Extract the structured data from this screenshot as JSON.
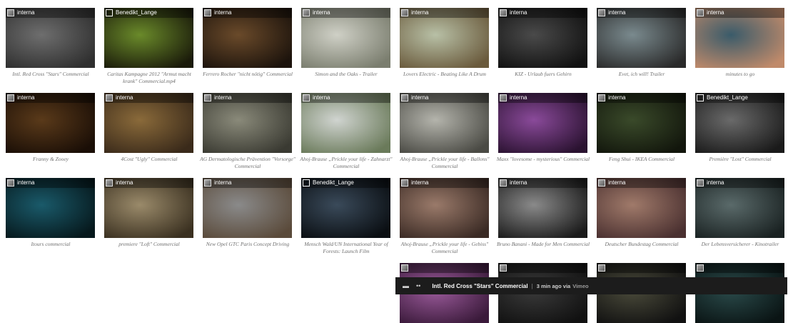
{
  "colors": {
    "player_bg": "#1c1c1c",
    "caption": "#6f6f6f",
    "page_bg": "#ffffff"
  },
  "videos": [
    {
      "author": "interna",
      "title": "Intl. Red Cross \"Stars\" Commercial",
      "thumb": "#6e6e6e,#2f2f2f"
    },
    {
      "author": "Benedikt_Lange",
      "title": "Caritas Kampagne 2012 \"Armut macht krank\" Commercial.mp4",
      "thumb": "#6a8a2a,#1a1a0a"
    },
    {
      "author": "interna",
      "title": "Ferrero Rocher \"nicht nötig\" Commercial",
      "thumb": "#6a4a2a,#1c130c"
    },
    {
      "author": "interna",
      "title": "Simon and the Oaks - Trailer",
      "thumb": "#cfd0c6,#7a7d6e"
    },
    {
      "author": "interna",
      "title": "Lovers Electric - Beating Like A Drum",
      "thumb": "#b8c0a6,#6a5a3c"
    },
    {
      "author": "interna",
      "title": "KIZ - Urlaub fuers Gehirn",
      "thumb": "#4a4a4a,#111111"
    },
    {
      "author": "interna",
      "title": "Evet, ich will! Trailer",
      "thumb": "#7a8a8e,#2a2a2a"
    },
    {
      "author": "interna",
      "title": "minutes to go",
      "thumb": "#3a5b6a,#c08a6a"
    },
    {
      "author": "interna",
      "title": "Franny & Zooey",
      "thumb": "#5a3a1a,#1a0e06"
    },
    {
      "author": "interna",
      "title": "4Cost \"Ugly\" Commercial",
      "thumb": "#8a6a3a,#3a2a1a"
    },
    {
      "author": "interna",
      "title": "AG Dermatologische Prävention \"Vorsorge\" Commercial",
      "thumb": "#8a8a7a,#3a3a32"
    },
    {
      "author": "interna",
      "title": "Ahoj-Brause „Prickle your life - Zahnarzt\" Commercial",
      "thumb": "#d0d4d0,#6a7a5a"
    },
    {
      "author": "interna",
      "title": "Ahoj-Brause „Prickle your life - Ballons\" Commercial",
      "thumb": "#b4b4ac,#4a4a44"
    },
    {
      "author": "interna",
      "title": "Maxx \"lovesome - mysterious\" Commercial",
      "thumb": "#8a4a9a,#2a1230"
    },
    {
      "author": "interna",
      "title": "Feng Shui - IKEA Commercial",
      "thumb": "#3a4a2a,#12160c"
    },
    {
      "author": "Benedikt_Lange",
      "title": "Première \"Lost\" Commercial",
      "thumb": "#6a6a6a,#1a1a1a"
    },
    {
      "author": "interna",
      "title": "Itours commercial",
      "thumb": "#1a5a6a,#06181c"
    },
    {
      "author": "interna",
      "title": "premiere \"Loft\" Commercial",
      "thumb": "#9a8a6a,#3a3020"
    },
    {
      "author": "interna",
      "title": "New Opel GTC Paris Concept Driving",
      "thumb": "#8a8a8a,#5a4a3a"
    },
    {
      "author": "Benedikt_Lange",
      "title": "Mensch Wald/UN International Year of Forests: Launch Film",
      "thumb": "#3a4a5a,#0a0e12"
    },
    {
      "author": "interna",
      "title": "Ahoj-Brause „Prickle your life - Gebiss\" Commercial",
      "thumb": "#9a7a6a,#3a2a24"
    },
    {
      "author": "interna",
      "title": "Bruno Banani - Made for Men Commercial",
      "thumb": "#8a8a8a,#1a1a1a"
    },
    {
      "author": "interna",
      "title": "Deutscher Bundestag Commercial",
      "thumb": "#a07a6a,#4a3030"
    },
    {
      "author": "interna",
      "title": "Der Lebensversicherer - Kinotrailer",
      "thumb": "#5a6a6a,#1a2222"
    }
  ],
  "partial_row": [
    {
      "thumb": "#9a5a9a,#3a1a3a"
    },
    {
      "thumb": "#3a3a3a,#111111"
    },
    {
      "thumb": "#4a4a3a,#111111"
    },
    {
      "thumb": "#2a4a4a,#0a1414"
    }
  ],
  "player": {
    "ctrl_minimize": "▬",
    "ctrl_expand": "••",
    "title": "Intl. Red Cross \"Stars\" Commercial",
    "separator": "|",
    "meta": "3 min ago via",
    "via": "Vimeo"
  }
}
